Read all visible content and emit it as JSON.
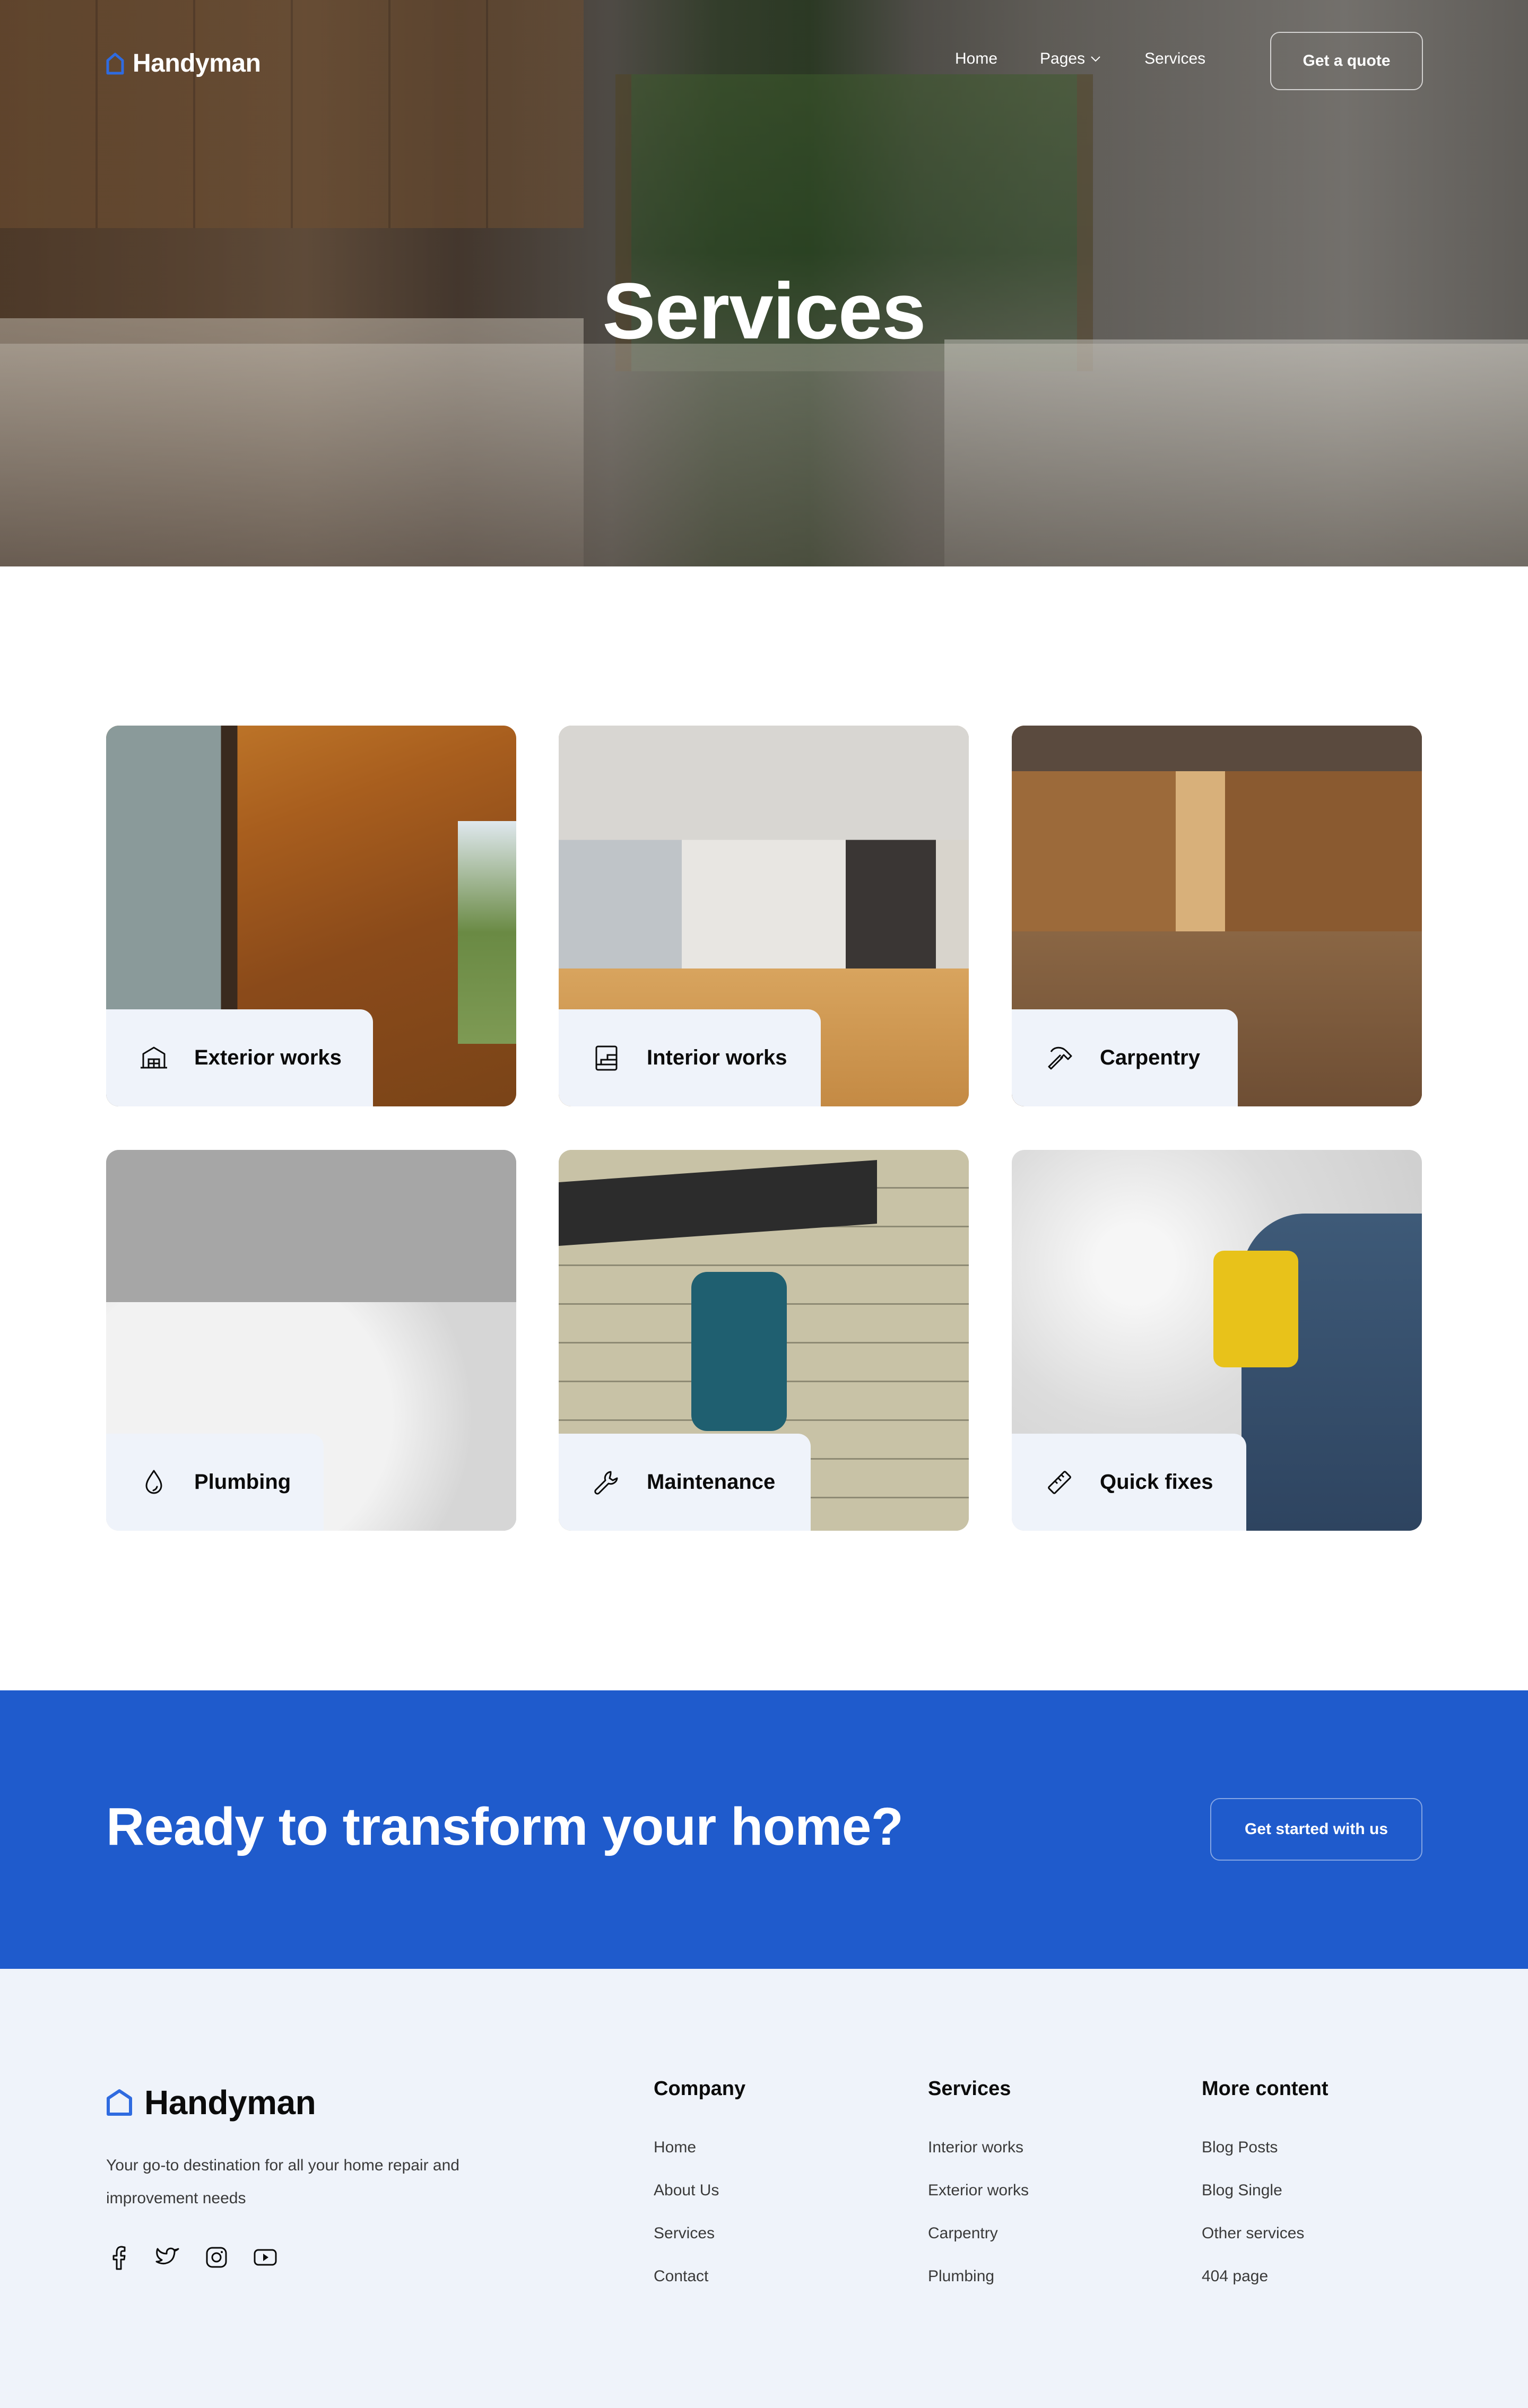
{
  "brand": {
    "name": "Handyman",
    "accent_color": "#1F5BCC"
  },
  "nav": {
    "links": [
      {
        "label": "Home"
      },
      {
        "label": "Pages",
        "has_dropdown": true
      },
      {
        "label": "Services"
      }
    ],
    "cta_label": "Get a quote"
  },
  "hero": {
    "title": "Services"
  },
  "services": [
    {
      "label": "Exterior works",
      "icon": "garage-icon"
    },
    {
      "label": "Interior works",
      "icon": "stairs-icon"
    },
    {
      "label": "Carpentry",
      "icon": "hammer-icon"
    },
    {
      "label": "Plumbing",
      "icon": "droplet-icon"
    },
    {
      "label": "Maintenance",
      "icon": "wrench-icon"
    },
    {
      "label": "Quick fixes",
      "icon": "ruler-icon"
    }
  ],
  "cta": {
    "title": "Ready to transform your home?",
    "button_label": "Get started with us",
    "background_color": "#1F5BCC"
  },
  "footer": {
    "brand_name": "Handyman",
    "tagline": "Your go-to destination for all your home repair and improvement needs",
    "socials": [
      "facebook-icon",
      "twitter-icon",
      "instagram-icon",
      "youtube-icon"
    ],
    "columns": [
      {
        "title": "Company",
        "links": [
          "Home",
          "About Us",
          "Services",
          "Contact"
        ]
      },
      {
        "title": "Services",
        "links": [
          "Interior works",
          "Exterior works",
          "Carpentry",
          "Plumbing"
        ]
      },
      {
        "title": "More content",
        "links": [
          "Blog Posts",
          "Blog Single",
          "Other services",
          "404 page"
        ]
      }
    ]
  }
}
